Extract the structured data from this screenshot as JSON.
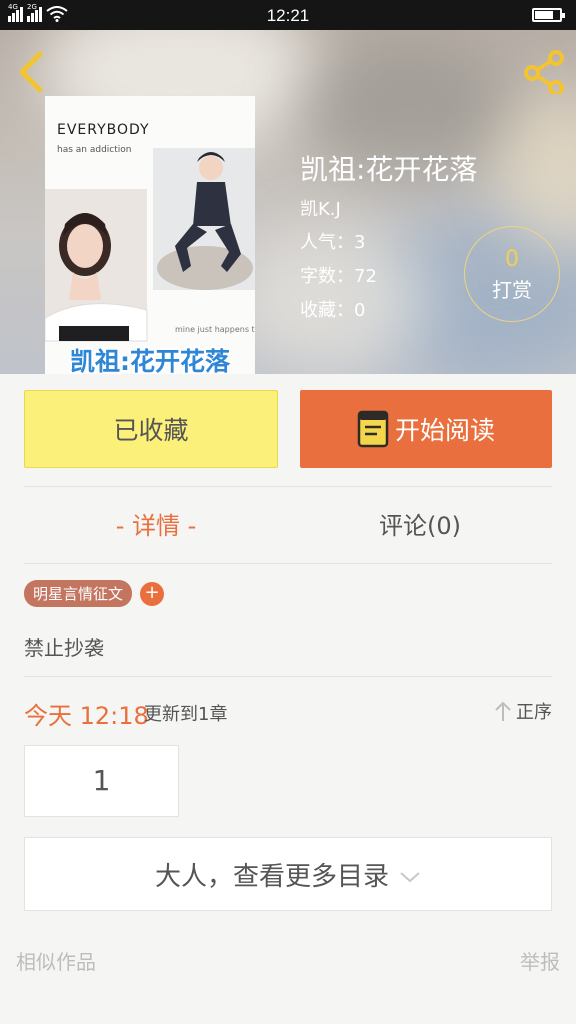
{
  "status_bar": {
    "time": "12:21",
    "signal_1_label": "4G",
    "signal_2_label": "2G",
    "icons": [
      "signal-icon",
      "wifi-icon",
      "battery-icon"
    ]
  },
  "header": {
    "back_icon": "chevron-left-icon",
    "share_icon": "share-icon",
    "accent": "#f4c430"
  },
  "book": {
    "cover_text": "凯祖:花开花落",
    "cover_header": "EVERYBODY",
    "cover_subheader": "has an addiction",
    "cover_tagline": "mine just happens to be you.",
    "title": "凯祖:花开花落",
    "author": "凯K.J",
    "popularity": "人气：3",
    "word_count": "字数：72",
    "favorites": "收藏：0"
  },
  "tip": {
    "count": "0",
    "label": "打赏"
  },
  "actions": {
    "favorited_label": "已收藏",
    "read_label": "开始阅读",
    "favorited_color": "#fbf07a",
    "read_color": "#e9703e"
  },
  "tabs": {
    "detail": "- 详情 -",
    "comments": "评论(0)"
  },
  "tags": {
    "items": [
      "明星言情征文"
    ],
    "add_label": "+"
  },
  "description": "禁止抄袭",
  "update": {
    "time": "今天 12:18",
    "text": "更新到1章",
    "sort_label": "正序"
  },
  "chapters": {
    "first": "1"
  },
  "more_catalog": "大人，查看更多目录",
  "footer": {
    "similar": "相似作品",
    "report": "举报"
  }
}
